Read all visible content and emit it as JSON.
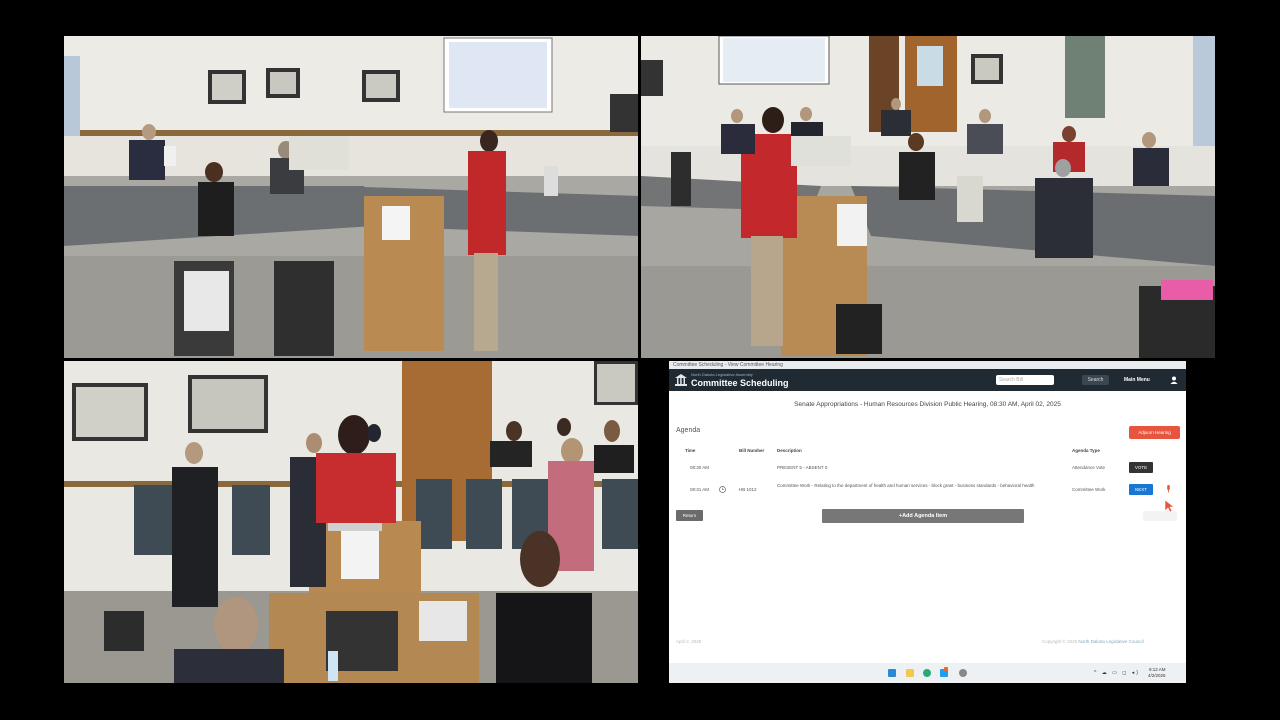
{
  "screen": {
    "window_title": "Committee Scheduling - View Committee Hearing",
    "header": {
      "state_label": "North Dakota Legislative Assembly",
      "app_title": "Committee Scheduling",
      "search_placeholder": "Search Bill",
      "search_label": "Search",
      "main_menu_label": "Main Menu"
    },
    "hearing_title": "Senate Appropriations - Human Resources Division Public Hearing, 08:30 AM, April 02, 2025",
    "agenda_label": "Agenda",
    "adjourn_label": "Adjourn Hearing",
    "columns": {
      "time": "Time",
      "bill_number": "Bill Number",
      "description": "Description",
      "agenda_type": "Agenda Type"
    },
    "rows": [
      {
        "time": "08:30 AM",
        "bill": "",
        "description": "PRESENT 5 - ABSENT 0",
        "agenda_type": "Attendance Vote",
        "action_label": "VOTE"
      },
      {
        "time": "08:31 AM",
        "bill": "HB 1012",
        "description": "Committee Work - Relating to the department of health and human services - block grant - business standards - behavioral health",
        "agenda_type": "Committee Work",
        "action_label": "NEXT"
      }
    ],
    "return_label": "Return",
    "add_item_label": "+Add Agenda Item",
    "footer_date": "April 2, 2025",
    "footer_copyright_prefix": "Copyright © 2025",
    "footer_copyright_link": "North Dakota Legislative Council",
    "taskbar": {
      "time": "9:12 AM",
      "date": "4/2/2025",
      "tray_symbols": "^ ☁ ▭ ◻ ◂)"
    },
    "colors": {
      "header_bg": "#1f2a33",
      "adjourn": "#e8553f",
      "next": "#1976d2",
      "vote": "#333333"
    }
  }
}
